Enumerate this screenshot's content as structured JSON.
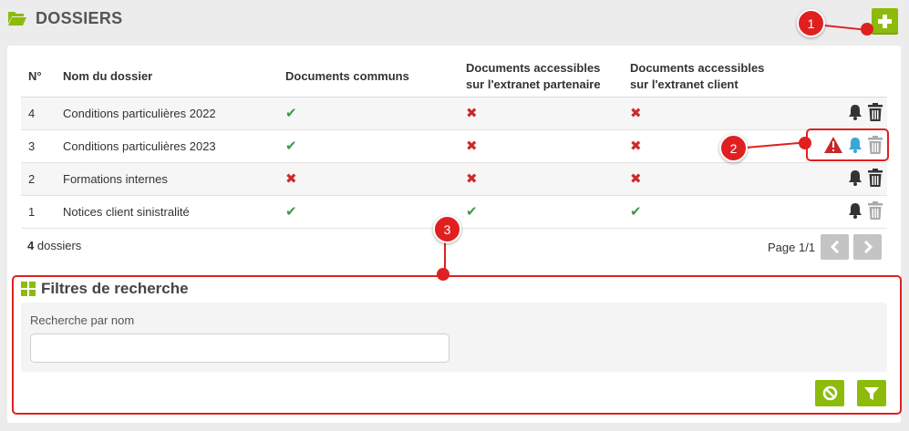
{
  "header": {
    "title": "DOSSIERS",
    "icon": "folder-open-icon"
  },
  "add_button": {
    "icon": "plus-icon"
  },
  "table": {
    "columns": [
      "N°",
      "Nom du dossier",
      "Documents communs",
      "Documents accessibles sur l'extranet partenaire",
      "Documents accessibles sur l'extranet client"
    ],
    "rows": [
      {
        "n": "4",
        "name": "Conditions particulières 2022",
        "common": "check",
        "partner": "cross",
        "client": "cross",
        "actions": [
          "bell-icon",
          "trash-icon"
        ]
      },
      {
        "n": "3",
        "name": "Conditions particulières 2023",
        "common": "check",
        "partner": "cross",
        "client": "cross",
        "actions": [
          "warning-icon",
          "bell-icon",
          "trash-icon"
        ]
      },
      {
        "n": "2",
        "name": "Formations internes",
        "common": "cross",
        "partner": "cross",
        "client": "cross",
        "actions": [
          "bell-icon",
          "trash-icon"
        ]
      },
      {
        "n": "1",
        "name": "Notices client sinistralité",
        "common": "check",
        "partner": "check",
        "client": "check",
        "actions": [
          "bell-icon",
          "trash-icon"
        ]
      }
    ]
  },
  "footer": {
    "count": "4",
    "count_label": "dossiers",
    "page": "Page 1/1"
  },
  "filters": {
    "title": "Filtres de recherche",
    "search_label": "Recherche par nom",
    "search_value": "",
    "reset_icon": "ban-icon",
    "apply_icon": "filter-icon"
  },
  "callouts": [
    "1",
    "2",
    "3"
  ],
  "colors": {
    "accent": "#8dbb0c",
    "annotation": "#e02020",
    "check": "#3d9a48",
    "cross": "#cc2b2b",
    "warning": "#c62828",
    "bell_active": "#3aa6d8"
  }
}
